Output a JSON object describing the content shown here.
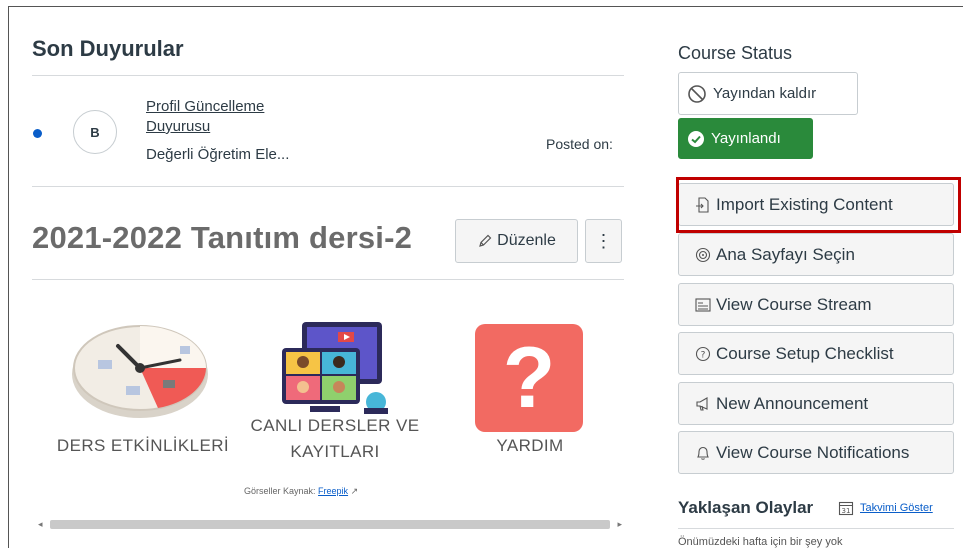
{
  "announcements": {
    "heading": "Son Duyurular",
    "items": [
      {
        "avatar": "B",
        "title": "Profil Güncelleme Duyurusu",
        "excerpt": "Değerli Öğretim Ele...",
        "posted_label": "Posted on:"
      }
    ]
  },
  "course": {
    "title": "2021-2022 Tanıtım dersi-2",
    "edit_label": "Düzenle",
    "more_label": "⋮"
  },
  "tiles": [
    {
      "label": "DERS ETKİNLİKLERİ",
      "icon": "clock-icon"
    },
    {
      "label_line1": "CANLI DERSLER VE",
      "label_line2": "KAYITLARI",
      "icon": "video-conference-icon"
    },
    {
      "label": "YARDIM",
      "icon": "question-icon",
      "glyph": "?"
    }
  ],
  "image_source": {
    "prefix": "Görseller Kaynak:",
    "link": "Freepik"
  },
  "sidebar": {
    "course_status_label": "Course Status",
    "unpublish_label": "Yayından kaldır",
    "published_label": "Yayınlandı",
    "buttons": [
      {
        "label": "Import Existing Content",
        "icon": "import-icon"
      },
      {
        "label": "Ana Sayfayı Seçin",
        "icon": "target-icon"
      },
      {
        "label": "View Course Stream",
        "icon": "stream-icon"
      },
      {
        "label": "Course Setup Checklist",
        "icon": "help-circle-icon"
      },
      {
        "label": "New Announcement",
        "icon": "megaphone-icon"
      },
      {
        "label": "View Course Notifications",
        "icon": "bell-icon"
      }
    ],
    "upcoming_heading": "Yaklaşan Olaylar",
    "calendar_link": "Takvimi Göster",
    "nothing_text": "Önümüzdeki hafta için bir şey yok"
  },
  "colors": {
    "published": "#2a8a3b",
    "highlight": "#c00000",
    "link": "#0a5ec9",
    "dot": "#0a5ec9",
    "help_tile": "#f26a62"
  }
}
